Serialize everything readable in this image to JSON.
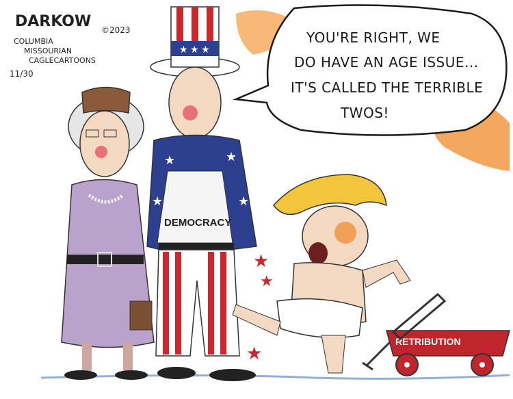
{
  "signature": {
    "name": "DARKOW",
    "line1": "COLUMBIA",
    "line2": "MISSOURIAN",
    "line3": "CAGLECARTOONS",
    "copyright": "©2023",
    "date": "11/30"
  },
  "speech_bubble": {
    "line1": "YOU'RE RIGHT, WE",
    "line2": "DO HAVE AN AGE ISSUE...",
    "line3": "IT'S CALLED THE TERRIBLE",
    "line4": "TWOS!"
  },
  "labels": {
    "shirt": "DEMOCRACY",
    "wagon": "RETRIBUTION"
  },
  "colors": {
    "lady_dress": "#b9a2cc",
    "uncle_sam_blue": "#2d3f8f",
    "stripe_red": "#c8282e",
    "wagon_red": "#c0252b",
    "hair_yellow": "#f2c53a",
    "orange_smudge": "#f08a2a",
    "skin": "#f3d8c2"
  }
}
